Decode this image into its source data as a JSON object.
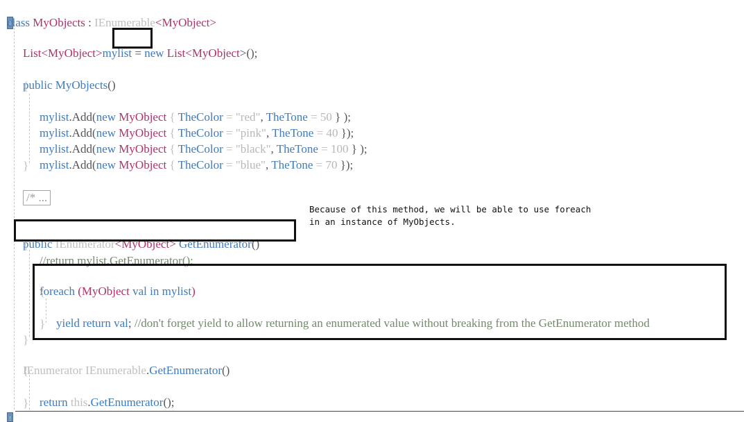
{
  "editor": {
    "lines": {
      "l1": {
        "kw": "class",
        "name": "MyObjects",
        "sep": " : ",
        "iface": "IEnumerable",
        "lt": "<",
        "arg": "MyObject",
        "gt": ">"
      },
      "l3": {
        "t1": "List",
        "lt": "<",
        "t2": "MyObject",
        "gt": ">",
        "var": "mylist",
        "eq": " = ",
        "kw": "new",
        "t3": "List",
        "lt2": "<",
        "t4": "MyObject",
        "end": ">();"
      },
      "l5": {
        "kw": "public",
        "name": "MyObjects",
        "paren": "()"
      },
      "l6": {
        "brace": "{"
      },
      "add1": {
        "obj": "mylist",
        "call": ".Add(",
        "kw": "new",
        "type": "MyObject",
        "ob": " { ",
        "p1": "TheColor",
        "eq1": " = ",
        "s": "\"red\"",
        "c": ", ",
        "p2": "TheTone",
        "eq2": " = ",
        "n": "50",
        "end": " } );"
      },
      "add2": {
        "obj": "mylist",
        "call": ".Add(",
        "kw": "new",
        "type": "MyObject",
        "ob": " { ",
        "p1": "TheColor",
        "eq1": " = ",
        "s": "\"pink\"",
        "c": ", ",
        "p2": "TheTone",
        "eq2": " = ",
        "n": "40",
        "end": " });"
      },
      "add3": {
        "obj": "mylist",
        "call": ".Add(",
        "kw": "new",
        "type": "MyObject",
        "ob": " { ",
        "p1": "TheColor",
        "eq1": " = ",
        "s": "\"black\"",
        "c": ", ",
        "p2": "TheTone",
        "eq2": " = ",
        "n": "100",
        "end": " } );"
      },
      "add4": {
        "obj": "mylist",
        "call": ".Add(",
        "kw": "new",
        "type": "MyObject",
        "ob": " { ",
        "p1": "TheColor",
        "eq1": " = ",
        "s": "\"blue\"",
        "c": ", ",
        "p2": "TheTone",
        "eq2": " = ",
        "n": "70",
        "end": " });"
      },
      "l11": {
        "brace": "}"
      },
      "collapsed": "/*  ...",
      "ge": {
        "kw": "public",
        "iface": "IEnumerator",
        "lt": "<",
        "arg": "MyObject",
        "gt": ">",
        "name": "GetEnumerator",
        "paren": "()"
      },
      "l15": {
        "brace": "{"
      },
      "l16": {
        "comment": "//return mylist.GetEnumerator();"
      },
      "fe": {
        "kw": "foreach",
        "op": " (",
        "type": "MyObject",
        "var": " val ",
        "kwin": "in",
        "list": " mylist",
        "cp": ")"
      },
      "l18": {
        "brace": "{"
      },
      "yr": {
        "kw": "yield return",
        "var": " val",
        "semi": "; ",
        "comment": "//don't forget yield to allow returning an enumerated value without breaking from the GetEnumerator method"
      },
      "l20": {
        "brace": "}"
      },
      "l21": {
        "brace": "}"
      },
      "ie": {
        "t1": "IEnumerator",
        "sp": " ",
        "t2": "IEnumerable",
        "dot": ".",
        "name": "GetEnumerator",
        "paren": "()"
      },
      "l23": {
        "brace": "{"
      },
      "rt": {
        "kw": "return",
        "sp": " ",
        "this": "this",
        "dot": ".",
        "name": "GetEnumerator",
        "end": "();"
      },
      "l25": {
        "brace": "}"
      }
    }
  },
  "annotation": {
    "line1": "Because of this method, we will be able to use foreach",
    "line2": "in an instance of MyObjects."
  }
}
